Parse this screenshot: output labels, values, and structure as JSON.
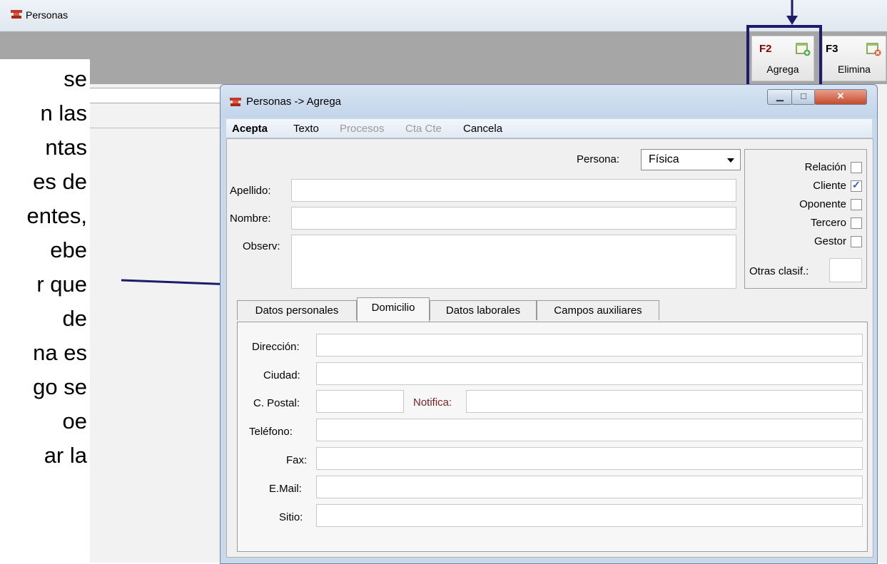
{
  "window": {
    "title": "Personas"
  },
  "toolbar": {
    "buttons": [
      {
        "key": "F2",
        "label": "Agrega"
      },
      {
        "key": "F3",
        "label": "Elimina"
      }
    ]
  },
  "overlay_text": [
    "se",
    "n las",
    "ntas",
    "es de",
    "entes,",
    "ebe",
    "r que",
    "de",
    "na es",
    "go se",
    "oe",
    "ar la"
  ],
  "dialog": {
    "title": "Personas -> Agrega",
    "menu": [
      "Acepta",
      "Texto",
      "Procesos",
      "Cta Cte",
      "Cancela"
    ],
    "persona_label": "Persona:",
    "persona_value": "Física",
    "fields": {
      "apellido_label": "Apellido:",
      "nombre_label": "Nombre:",
      "observ_label": "Observ:"
    },
    "classifications": [
      {
        "label": "Relación",
        "checked": false
      },
      {
        "label": "Cliente",
        "checked": true
      },
      {
        "label": "Oponente",
        "checked": false
      },
      {
        "label": "Tercero",
        "checked": false
      },
      {
        "label": "Gestor",
        "checked": false
      }
    ],
    "otras_label": "Otras clasif.:",
    "tabs": [
      "Datos personales",
      "Domicilio",
      "Datos laborales",
      "Campos auxiliares"
    ],
    "active_tab": "Domicilio",
    "domicilio": {
      "direccion": "Dirección:",
      "ciudad": "Ciudad:",
      "cpostal": "C. Postal:",
      "notifica": "Notifica:",
      "telefono": "Teléfono:",
      "fax": "Fax:",
      "email": "E.Mail:",
      "sitio": "Sitio:"
    }
  },
  "colors": {
    "highlight_box": "#1c1c6b",
    "notifica_label": "#7a1f1f",
    "checkmark": "#2a5fb3"
  }
}
